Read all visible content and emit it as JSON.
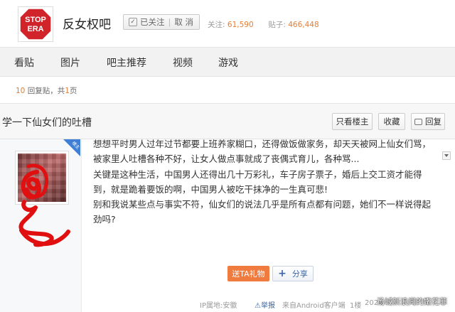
{
  "header": {
    "logo_text": [
      "STOP",
      "ERA"
    ],
    "forum_name": "反女权吧",
    "follow_label": "已关注",
    "follow_separator": "|",
    "cancel_label": "取 消",
    "followers_label": "关注:",
    "followers_count": "61,590",
    "posts_label": "贴子:",
    "posts_count": "466,448"
  },
  "nav": {
    "items": [
      "看贴",
      "图片",
      "吧主推荐",
      "视频",
      "游戏"
    ]
  },
  "reply_info": {
    "count": "10",
    "text_mid": " 回复贴，共",
    "pages": "1",
    "text_end": "页"
  },
  "thread": {
    "title": "学一下仙女们的吐槽",
    "only_op_label": "只看楼主",
    "favorite_label": "收藏",
    "reply_label": "回复"
  },
  "post": {
    "badge_label": "楼主",
    "paragraphs": [
      "想想平时男人过年过节都要上班养家糊口，还得做饭做家务，却天天被网上仙女们骂，被家里人吐槽各种不好，让女人做点事就成了丧偶式育儿，各种骂...",
      "关键是这种生活，中国男人还得出几十万彩礼，车子房子票子，婚后上交工资才能得到，就是跪着要饭的啊，中国男人被吃干抹净的一生真可悲!",
      "别和我说某些点与事实不符，仙女们的说法几乎是所有点都有问题，她们不一样说得起劲吗?"
    ],
    "gift_label": "送TA礼物",
    "share_label": "分享",
    "ip_location": "IP属地:安徽",
    "report_label": "举报",
    "client": "来自Android客户端",
    "floor": "1楼",
    "date_partial": "2024",
    "watermark": "汤城新浪闻的嫩花菲"
  },
  "colors": {
    "accent_orange": "#e77d31",
    "gift_button": "#f07b3e",
    "link_blue": "#3a65a8",
    "badge_blue": "#3f7fd6",
    "logo_red": "#d0232a"
  }
}
